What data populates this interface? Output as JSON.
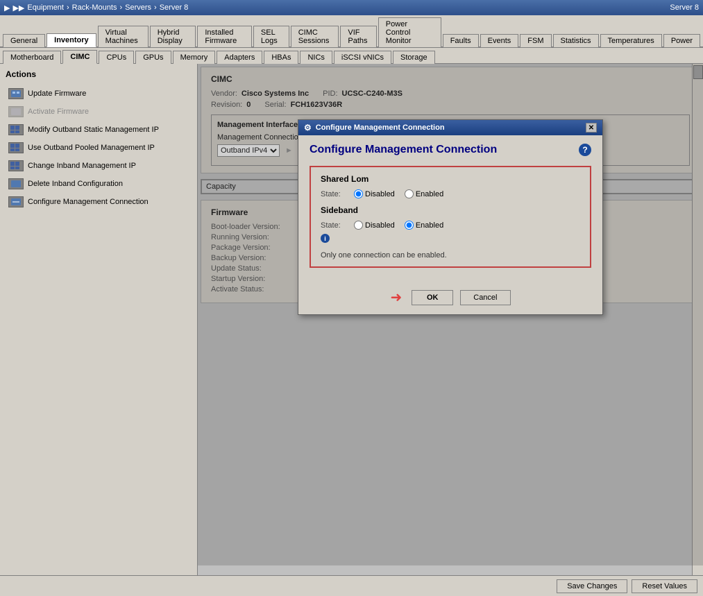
{
  "breadcrumb": {
    "items": [
      "Equipment",
      "Rack-Mounts",
      "Servers",
      "Server 8"
    ],
    "current": "Server 8"
  },
  "main_tabs": [
    {
      "label": "General",
      "active": false
    },
    {
      "label": "Inventory",
      "active": true
    },
    {
      "label": "Virtual Machines",
      "active": false
    },
    {
      "label": "Hybrid Display",
      "active": false
    },
    {
      "label": "Installed Firmware",
      "active": false
    },
    {
      "label": "SEL Logs",
      "active": false
    },
    {
      "label": "CIMC Sessions",
      "active": false
    },
    {
      "label": "VIF Paths",
      "active": false
    },
    {
      "label": "Power Control Monitor",
      "active": false
    },
    {
      "label": "Faults",
      "active": false
    },
    {
      "label": "Events",
      "active": false
    },
    {
      "label": "FSM",
      "active": false
    },
    {
      "label": "Statistics",
      "active": false
    },
    {
      "label": "Temperatures",
      "active": false
    },
    {
      "label": "Power",
      "active": false
    }
  ],
  "sub_tabs": [
    {
      "label": "Motherboard",
      "active": false
    },
    {
      "label": "CIMC",
      "active": true
    },
    {
      "label": "CPUs",
      "active": false
    },
    {
      "label": "GPUs",
      "active": false
    },
    {
      "label": "Memory",
      "active": false
    },
    {
      "label": "Adapters",
      "active": false
    },
    {
      "label": "HBAs",
      "active": false
    },
    {
      "label": "NICs",
      "active": false
    },
    {
      "label": "iSCSI vNICs",
      "active": false
    },
    {
      "label": "Storage",
      "active": false
    }
  ],
  "sidebar": {
    "title": "Actions",
    "actions": [
      {
        "label": "Update Firmware",
        "enabled": true
      },
      {
        "label": "Activate Firmware",
        "enabled": false
      },
      {
        "label": "Modify Outband Static Management IP",
        "enabled": true
      },
      {
        "label": "Use Outband Pooled Management IP",
        "enabled": true
      },
      {
        "label": "Change Inband Management IP",
        "enabled": true
      },
      {
        "label": "Delete Inband Configuration",
        "enabled": true
      },
      {
        "label": "Configure Management Connection",
        "enabled": true
      }
    ]
  },
  "cimc": {
    "section_title": "CIMC",
    "vendor_label": "Vendor:",
    "vendor_value": "Cisco Systems Inc",
    "pid_label": "PID:",
    "pid_value": "UCSC-C240-M3S",
    "revision_label": "Revision:",
    "revision_value": "0",
    "serial_label": "Serial:",
    "serial_value": "FCH1623V36R",
    "mgmt_interface_title": "Management Interface",
    "mgmt_connection_label": "Management Connection:"
  },
  "firmware": {
    "section_title": "Firmware",
    "boot_loader_label": "Boot-loader Version:",
    "boot_loader_value": "",
    "running_label": "Running Version:",
    "running_value": "",
    "package_label": "Package Version:",
    "package_value": "",
    "backup_label": "Backup Version:",
    "backup_value": "",
    "update_status_label": "Update Status:",
    "update_status_value": "",
    "startup_label": "Startup Version:",
    "startup_value": "",
    "activate_status_label": "Activate Status:",
    "activate_status_value": ""
  },
  "table": {
    "capacity_header": "Capacity"
  },
  "modal": {
    "titlebar": "Configure Management Connection",
    "title": "Configure Management Connection",
    "shared_lom": {
      "section_title": "Shared Lom",
      "state_label": "State:",
      "disabled_label": "Disabled",
      "enabled_label": "Enabled",
      "disabled_checked": true,
      "enabled_checked": false
    },
    "sideband": {
      "section_title": "Sideband",
      "state_label": "State:",
      "disabled_label": "Disabled",
      "enabled_label": "Enabled",
      "disabled_checked": false,
      "enabled_checked": true
    },
    "note": "Only one connection can be enabled.",
    "ok_label": "OK",
    "cancel_label": "Cancel"
  },
  "bottom_bar": {
    "save_label": "Save Changes",
    "reset_label": "Reset Values"
  }
}
